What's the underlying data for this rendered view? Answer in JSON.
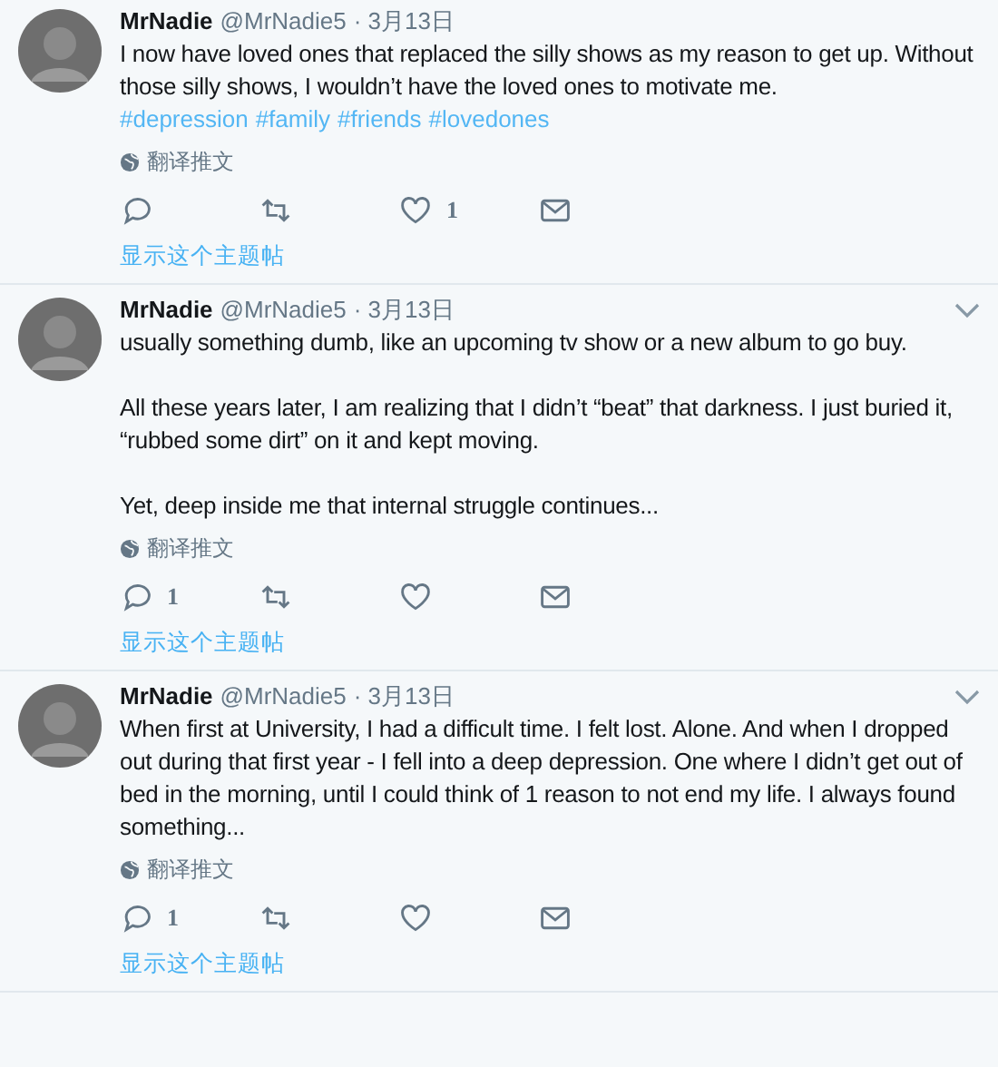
{
  "tweets": [
    {
      "name": "MrNadie",
      "handle": "@MrNadie5",
      "date": "· 3月13日",
      "caret": false,
      "paragraphs": [
        "I now have loved ones that replaced the silly shows as my reason to get up. Without those silly shows, I wouldn’t have the loved ones to motivate me."
      ],
      "hashtags": [
        "#depression",
        "#family",
        "#friends",
        "#lovedones"
      ],
      "translate": "翻译推文",
      "actions": [
        {
          "kind": "reply"
        },
        {
          "kind": "retweet"
        },
        {
          "kind": "like",
          "count": "1"
        },
        {
          "kind": "message"
        }
      ],
      "thread_link": "显示这个主题帖"
    },
    {
      "name": "MrNadie",
      "handle": "@MrNadie5",
      "date": "· 3月13日",
      "caret": true,
      "paragraphs": [
        "usually something dumb, like an upcoming tv show or a new album to go buy.",
        "All these years later, I am realizing that I didn’t “beat” that darkness. I just buried it, “rubbed some dirt” on it and kept moving.",
        "Yet, deep inside me that internal struggle continues..."
      ],
      "translate": "翻译推文",
      "actions": [
        {
          "kind": "reply",
          "count": "1"
        },
        {
          "kind": "retweet"
        },
        {
          "kind": "like"
        },
        {
          "kind": "message"
        }
      ],
      "thread_link": "显示这个主题帖"
    },
    {
      "name": "MrNadie",
      "handle": "@MrNadie5",
      "date": "· 3月13日",
      "caret": true,
      "paragraphs": [
        "When first at University, I had a difficult time. I felt lost. Alone. And when I dropped out during that first year - I fell into a deep depression. One where I didn’t get out of bed in the morning, until I could think of 1 reason to not end my life. I always found something..."
      ],
      "translate": "翻译推文",
      "actions": [
        {
          "kind": "reply",
          "count": "1"
        },
        {
          "kind": "retweet"
        },
        {
          "kind": "like"
        },
        {
          "kind": "message"
        }
      ],
      "thread_link": "显示这个主题帖"
    }
  ]
}
